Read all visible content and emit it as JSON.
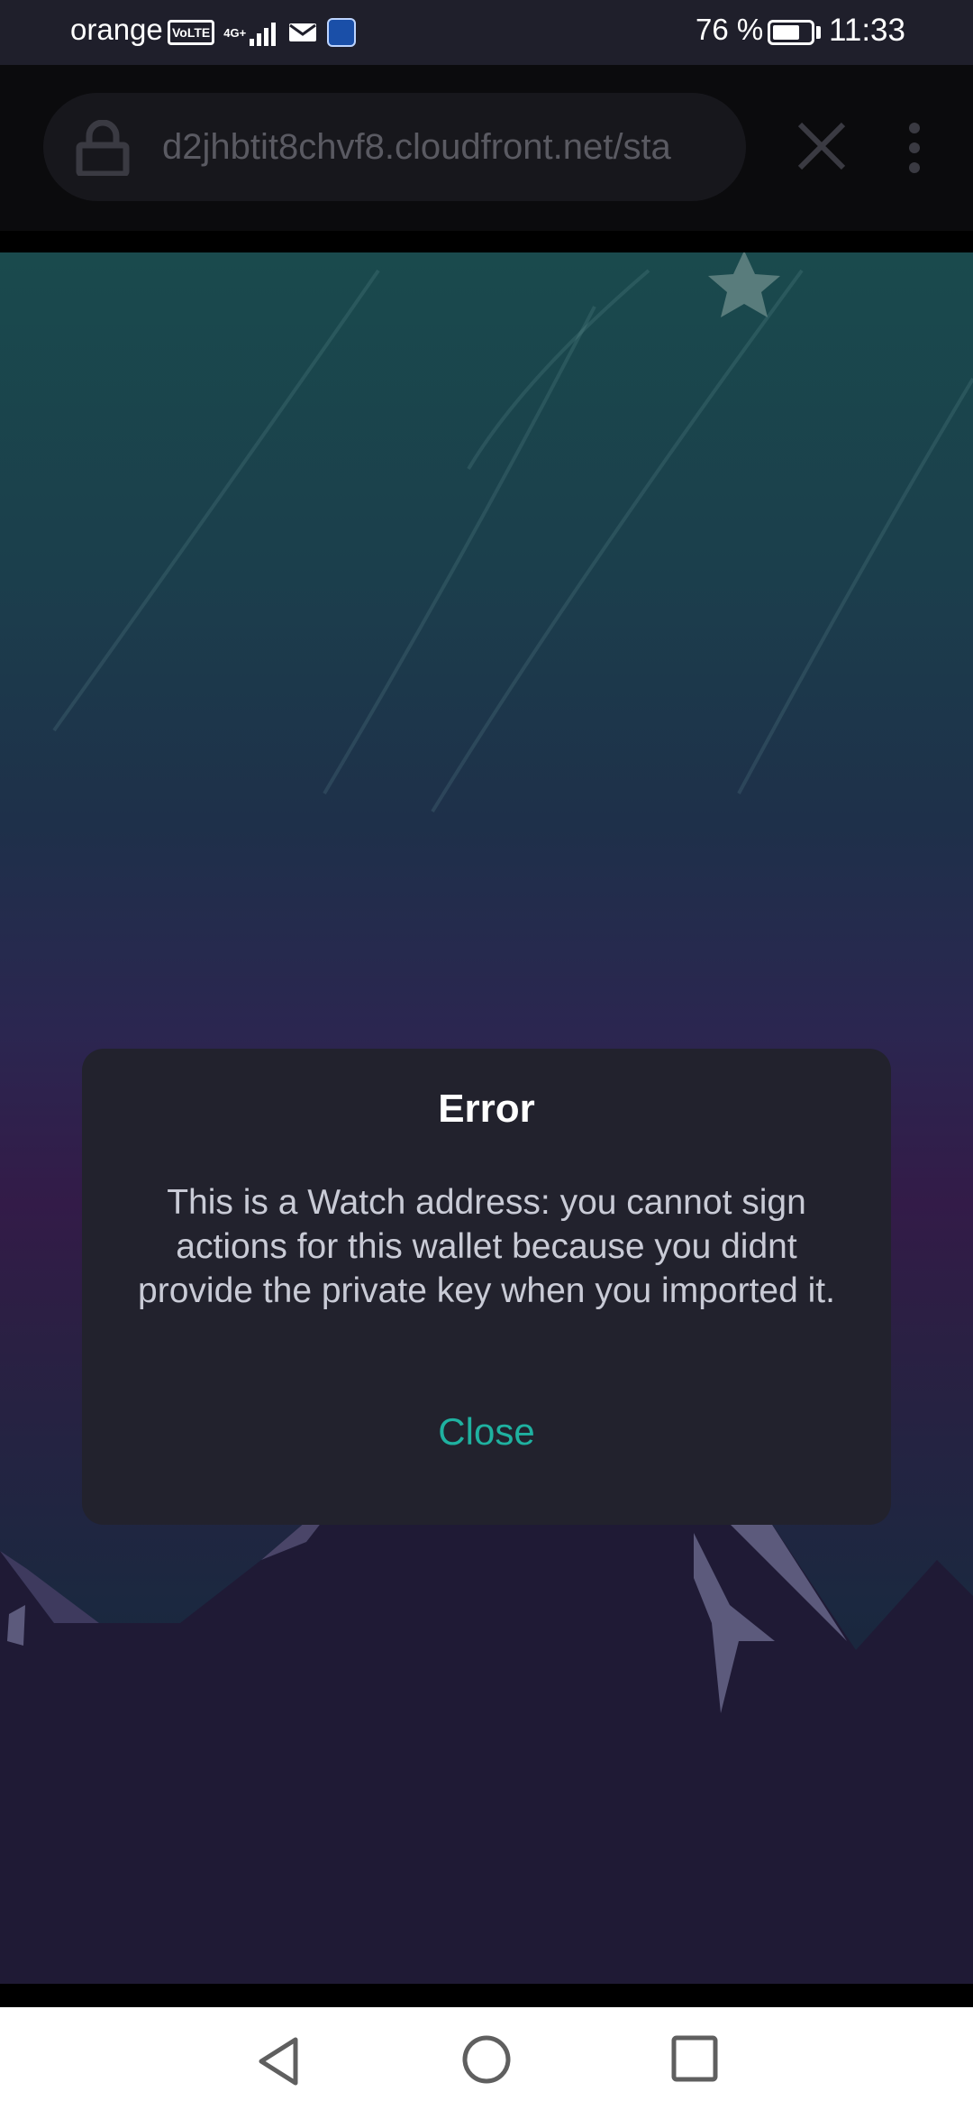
{
  "status_bar": {
    "carrier": "orange",
    "volte": "VoLTE",
    "network": "4G+",
    "battery_percent": "76 %",
    "battery_level": 0.76,
    "time": "11:33",
    "icons": [
      "volte-icon",
      "signal-icon",
      "mail-icon",
      "app-notification-icon",
      "battery-icon"
    ]
  },
  "browser": {
    "url": "d2jhbtit8chvf8.cloudfront.net/sta",
    "icons": {
      "lock": "lock-icon",
      "close": "close-icon",
      "menu": "more-vert-icon"
    }
  },
  "dialog": {
    "title": "Error",
    "message": "This is a Watch address: you cannot sign actions for this wallet because you didnt provide the private key when you imported it.",
    "close_label": "Close"
  },
  "nav_bar": {
    "icons": [
      "back-icon",
      "home-icon",
      "recents-icon"
    ]
  },
  "colors": {
    "dialog_bg": "#22222d",
    "accent": "#1fb1a0",
    "status_bar_bg": "#1f1f2b",
    "toolbar_bg": "#0b0b0d"
  }
}
